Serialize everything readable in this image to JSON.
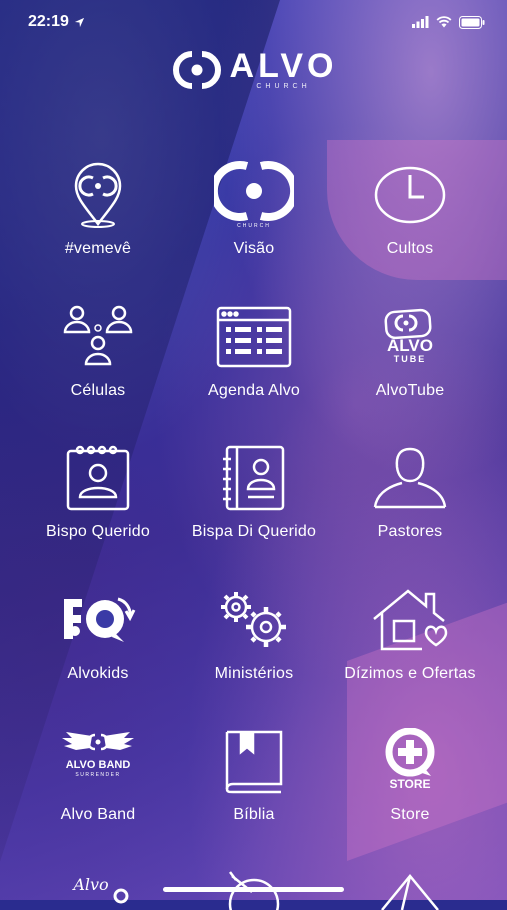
{
  "status_bar": {
    "time": "22:19"
  },
  "app": {
    "logo_title": "ALVO",
    "logo_subtitle": "CHURCH"
  },
  "menu": [
    {
      "label": "#vemevê",
      "icon": "location-pin-icon"
    },
    {
      "label": "Visão",
      "icon": "alvo-target-icon"
    },
    {
      "label": "Cultos",
      "icon": "clock-icon"
    },
    {
      "label": "Células",
      "icon": "group-people-icon"
    },
    {
      "label": "Agenda Alvo",
      "icon": "calendar-grid-icon"
    },
    {
      "label": "AlvoTube",
      "icon": "alvotube-logo-icon"
    },
    {
      "label": "Bispo Querido",
      "icon": "contact-card-icon"
    },
    {
      "label": "Bispa Di Querido",
      "icon": "address-book-icon"
    },
    {
      "label": "Pastores",
      "icon": "person-bust-icon"
    },
    {
      "label": "Alvokids",
      "icon": "alvokids-logo-icon"
    },
    {
      "label": "Ministérios",
      "icon": "gears-icon"
    },
    {
      "label": "Dízimos e Ofertas",
      "icon": "house-heart-icon"
    },
    {
      "label": "Alvo Band",
      "icon": "alvo-band-logo-icon"
    },
    {
      "label": "Bíblia",
      "icon": "bible-icon"
    },
    {
      "label": "Store",
      "icon": "store-logo-icon"
    }
  ],
  "alvoband_logo": {
    "line1": "ALVO BAND",
    "line2": "SURRENDER"
  },
  "alvotube_logo": {
    "line1": "ALVO",
    "line2": "TUBE"
  },
  "store_logo": {
    "text": "STORE"
  },
  "visao_logo": {
    "text": "CHURCH"
  },
  "bottom_partial": [
    {
      "icon": "alvo-script-logo-icon",
      "text": "Alvo"
    },
    {
      "icon": "target-arrow-icon"
    },
    {
      "icon": "tent-icon"
    }
  ]
}
